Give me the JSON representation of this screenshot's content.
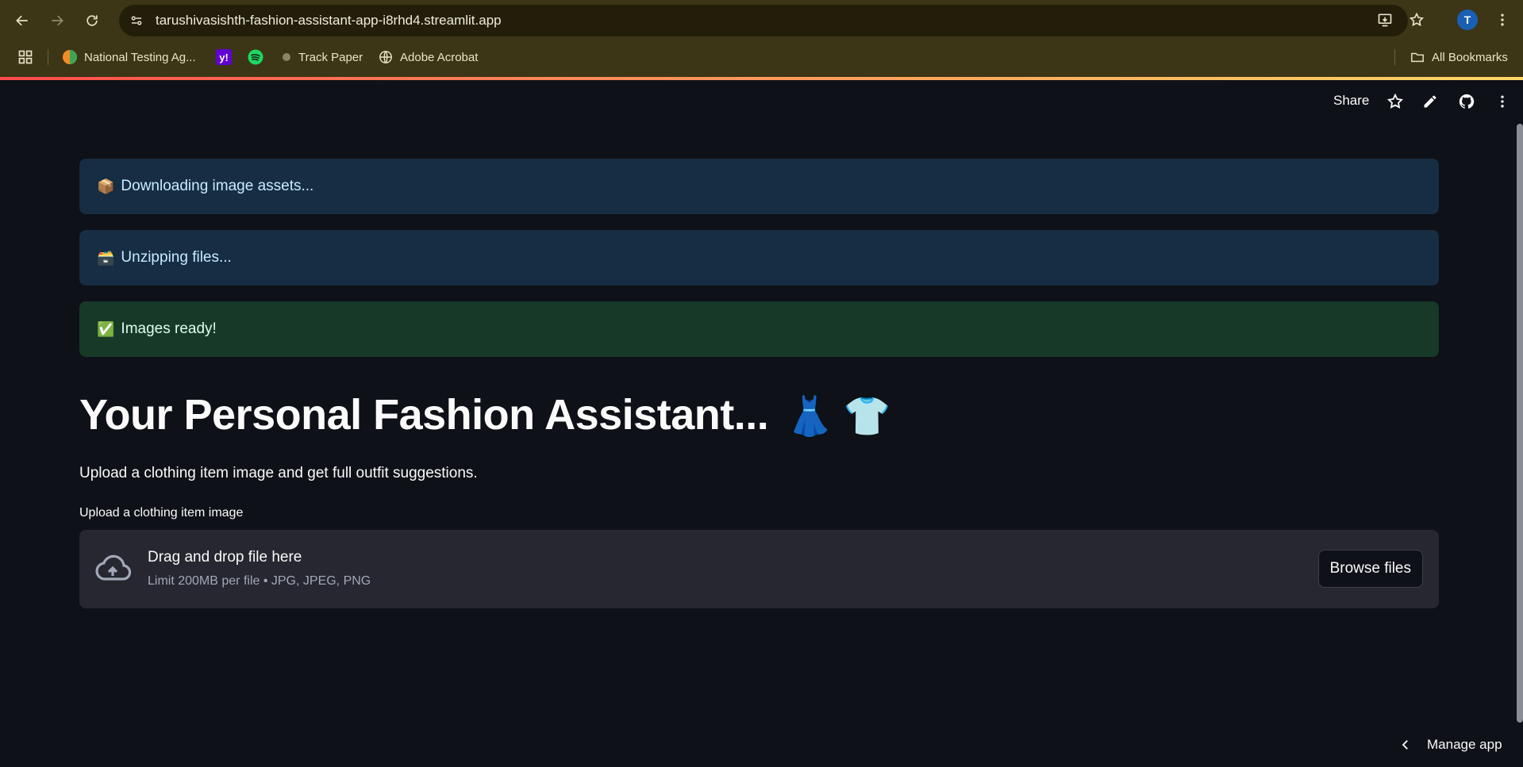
{
  "browser": {
    "url": "tarushivasishth-fashion-assistant-app-i8rhd4.streamlit.app",
    "profile_initial": "T",
    "bookmarks": [
      {
        "label": "National Testing Ag..."
      },
      {
        "label": ""
      },
      {
        "label": ""
      },
      {
        "label": "Track Paper"
      },
      {
        "label": "Adobe Acrobat"
      }
    ],
    "all_bookmarks": "All Bookmarks"
  },
  "header": {
    "share_label": "Share"
  },
  "alerts": [
    {
      "emoji": "📦",
      "text": "Downloading image assets...",
      "kind": "info"
    },
    {
      "emoji": "🗃️",
      "text": "Unzipping files...",
      "kind": "info"
    },
    {
      "emoji": "✅",
      "text": "Images ready!",
      "kind": "success"
    }
  ],
  "main": {
    "title": "Your Personal Fashion Assistant...",
    "title_emojis": "👗 👕",
    "subtitle": "Upload a clothing item image and get full outfit suggestions.",
    "upload_label": "Upload a clothing item image",
    "dropzone_main": "Drag and drop file here",
    "dropzone_sub": "Limit 200MB per file • JPG, JPEG, PNG",
    "browse_label": "Browse files"
  },
  "footer": {
    "manage_label": "Manage app"
  },
  "colors": {
    "background": "#0e1117",
    "info_bg": "#172d43",
    "success_bg": "#173928",
    "chrome_bg": "#3c3516"
  }
}
